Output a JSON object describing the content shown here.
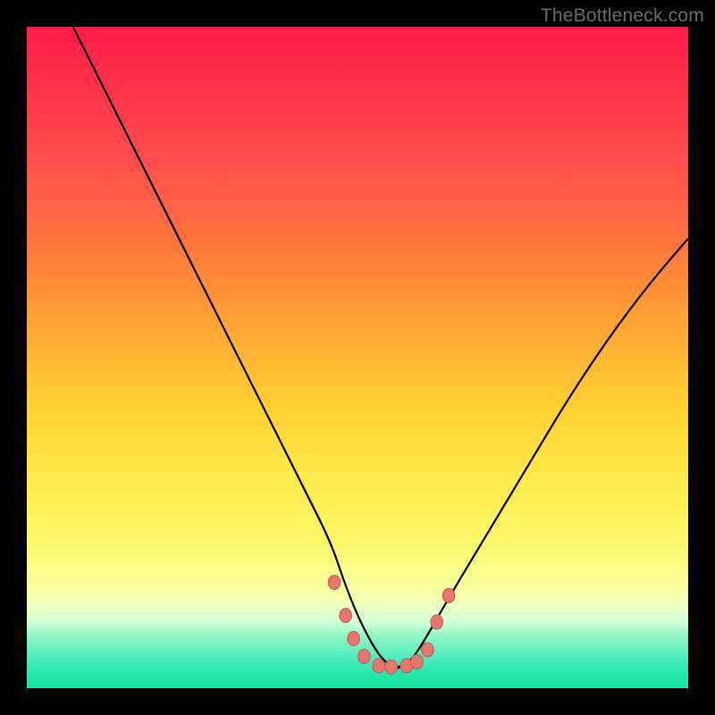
{
  "watermark": "TheBottleneck.com",
  "colors": {
    "marker_fill": "#e6766e",
    "marker_stroke": "#c45a52",
    "curve_stroke": "#000000"
  },
  "chart_data": {
    "type": "line",
    "title": "",
    "xlabel": "",
    "ylabel": "",
    "xlim": [
      0,
      100
    ],
    "ylim": [
      0,
      100
    ],
    "description": "V-shaped bottleneck curve. Y corresponds to mismatch percentage (high = red = bad, low = green = good). Pink dots mark the low-bottleneck region near the trough.",
    "series": [
      {
        "name": "bottleneck_curve",
        "x": [
          7,
          10,
          14,
          18,
          22,
          26,
          30,
          34,
          38,
          42,
          46,
          48,
          50,
          52,
          54,
          56,
          58,
          60,
          64,
          70,
          76,
          82,
          88,
          94,
          100
        ],
        "y": [
          100,
          94,
          86,
          78,
          70,
          62,
          54,
          46,
          38,
          30,
          22,
          16,
          11,
          7,
          4,
          3,
          4,
          7,
          14,
          24,
          34,
          44,
          53,
          61,
          68
        ]
      }
    ],
    "markers": [
      {
        "x": 46.5,
        "y": 16
      },
      {
        "x": 48.2,
        "y": 11
      },
      {
        "x": 49.4,
        "y": 7.5
      },
      {
        "x": 51.0,
        "y": 4.8
      },
      {
        "x": 53.2,
        "y": 3.4
      },
      {
        "x": 55.1,
        "y": 3.2
      },
      {
        "x": 57.4,
        "y": 3.4
      },
      {
        "x": 59.0,
        "y": 4.0
      },
      {
        "x": 60.6,
        "y": 5.8
      },
      {
        "x": 62.0,
        "y": 10
      },
      {
        "x": 63.8,
        "y": 14
      }
    ],
    "marker_radius": 8
  }
}
